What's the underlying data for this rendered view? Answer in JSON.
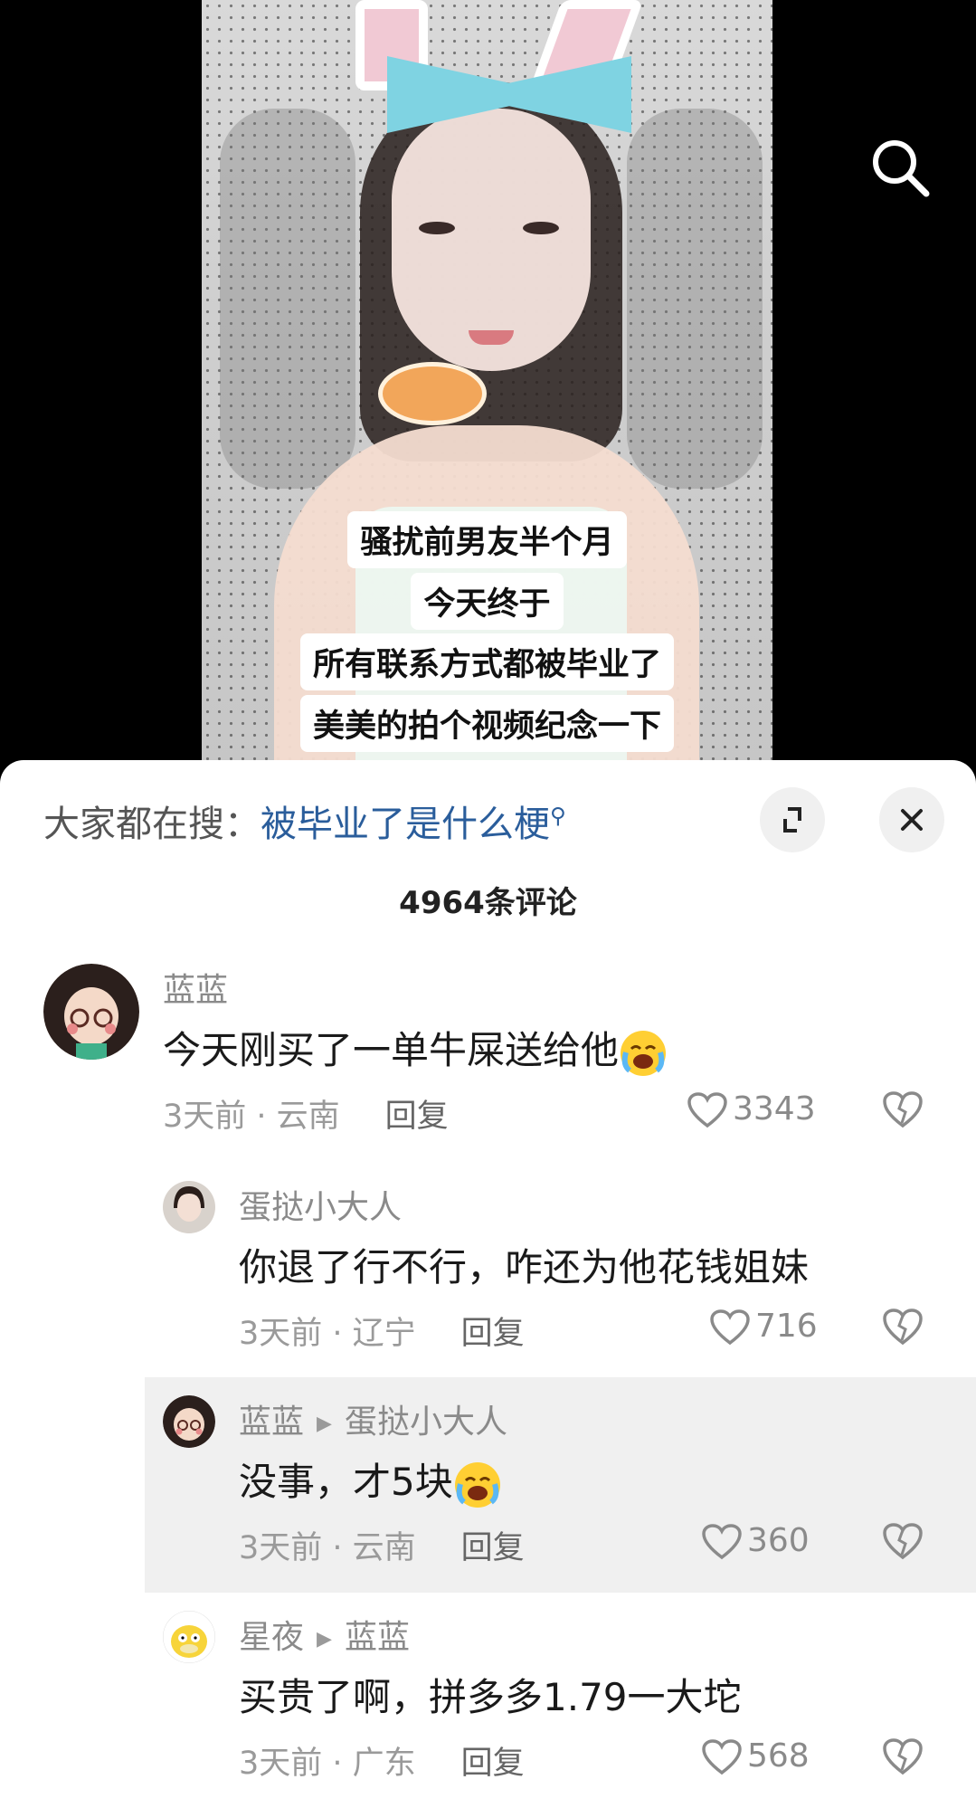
{
  "video": {
    "caption_lines": [
      "骚扰前男友半个月",
      "今天终于",
      "所有联系方式都被毕业了",
      "美美的拍个视频纪念一下"
    ]
  },
  "sheet": {
    "suggest_prefix": "大家都在搜：",
    "suggest_query": "被毕业了是什么梗",
    "comment_count": "4964条评论"
  },
  "comments": [
    {
      "name": "蓝蓝",
      "text": "今天刚买了一单牛屎送给他",
      "time": "3天前 · 云南",
      "reply": "回复",
      "likes": "3343"
    },
    {
      "name": "蛋挞小大人",
      "text": "你退了行不行，咋还为他花钱姐妹",
      "time": "3天前 · 辽宁",
      "reply": "回复",
      "likes": "716"
    },
    {
      "name": "蓝蓝",
      "reply_to": "蛋挞小大人",
      "text": "没事，才5块",
      "time": "3天前 · 云南",
      "reply": "回复",
      "likes": "360"
    },
    {
      "name": "星夜",
      "reply_to": "蓝蓝",
      "text": "买贵了啊，拼多多1.79一大坨",
      "time": "3天前 · 广东",
      "reply": "回复",
      "likes": "568"
    }
  ],
  "colors": {
    "link": "#2a5d9b",
    "muted": "#8a8a8a",
    "highlight_bg": "#f0f0f0"
  },
  "icons": [
    "search-icon",
    "expand-icon",
    "close-icon",
    "heart-icon",
    "broken-heart-icon",
    "crying-laugh-emoji"
  ]
}
